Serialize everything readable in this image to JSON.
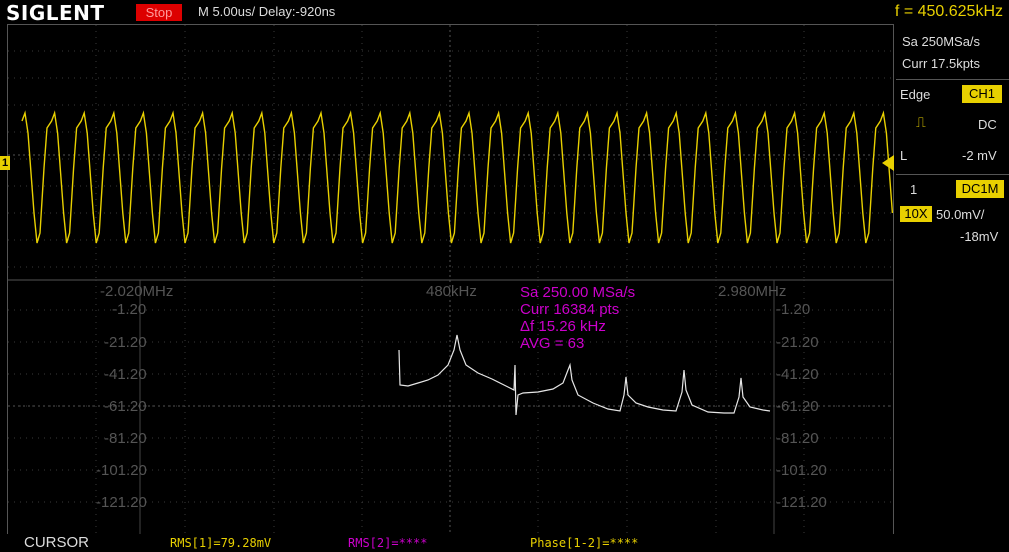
{
  "header": {
    "brand": "SIGLENT",
    "run_state": "Stop",
    "timebase": "M 5.00us/  Delay:-920ns",
    "frequency": "f = 450.625kHz"
  },
  "side_panel": {
    "sample_rate": "Sa 250MSa/s",
    "memory": "Curr 17.5kpts",
    "trigger_type": "Edge",
    "trigger_source": "CH1",
    "trigger_coupling": "DC",
    "trigger_level_label": "L",
    "trigger_level": "-2 mV",
    "channel_number": "1",
    "channel_coupling": "DC1M",
    "probe": "10X",
    "volts_div": "50.0mV/",
    "offset": "-18mV"
  },
  "markers": {
    "channel_marker": "1"
  },
  "fft": {
    "x_labels": [
      "-2.020MHz",
      "480kHz",
      "2.980MHz"
    ],
    "y_labels": [
      "-1.20",
      "-21.20",
      "-41.20",
      "-61.20",
      "-81.20",
      "-101.20",
      "-121.20"
    ],
    "info": [
      "Sa 250.00 MSa/s",
      "Curr 16384 pts",
      "Δf 15.26 kHz",
      "AVG = 63"
    ]
  },
  "footer": {
    "menu": "CURSOR",
    "rms1": "RMS[1]=79.28mV",
    "rms2": "RMS[2]=****",
    "phase": "Phase[1-2]=****"
  },
  "colors": {
    "ch1": "#e8d000",
    "math": "#cc00cc",
    "trigger_marker": "#2aa7e0",
    "stop_bg": "#dd0000"
  }
}
